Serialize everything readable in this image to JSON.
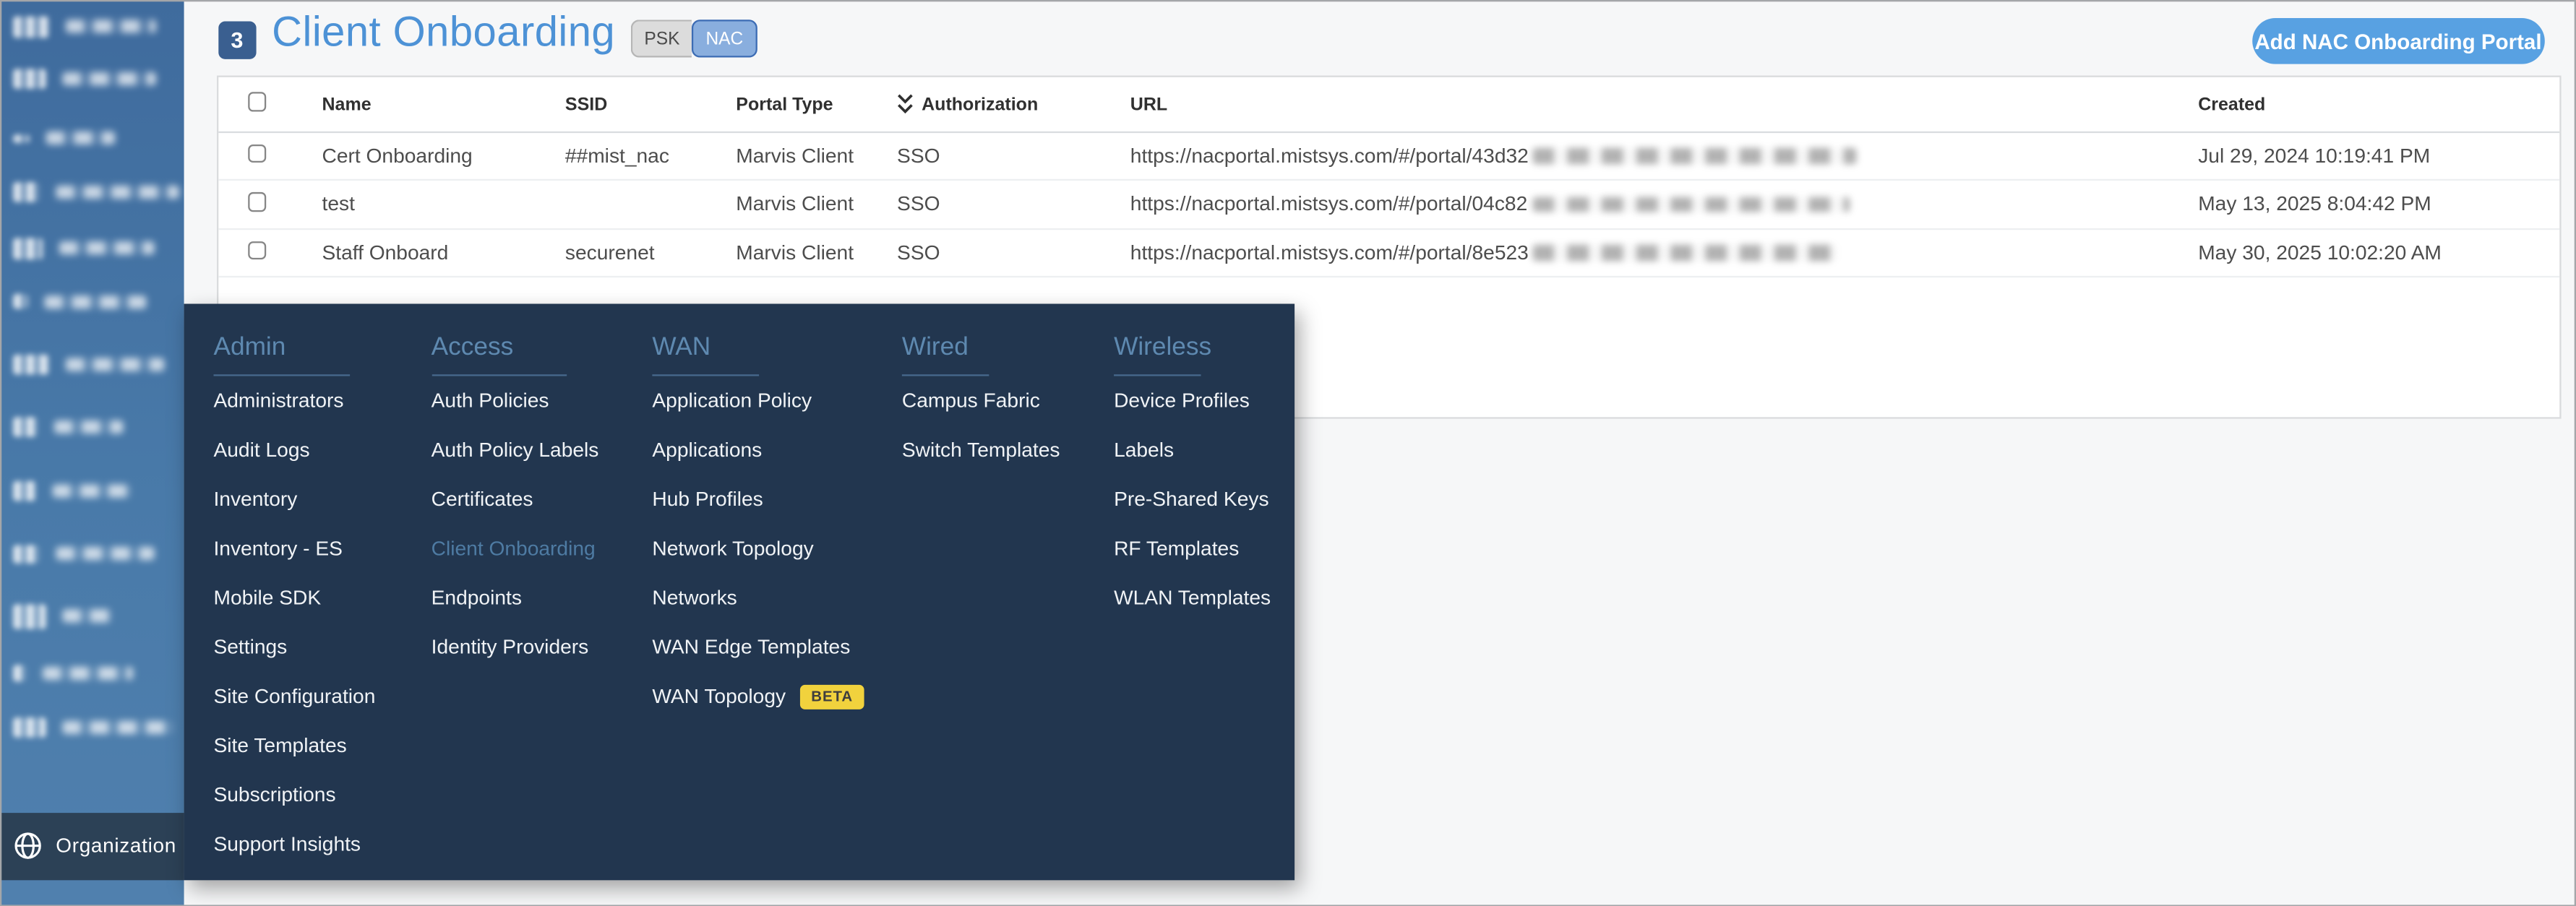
{
  "page": {
    "count_badge": "3",
    "title": "Client Onboarding",
    "toggle": {
      "options": [
        "PSK",
        "NAC"
      ],
      "selected": "NAC"
    },
    "add_button": "Add NAC Onboarding Portal"
  },
  "table": {
    "columns": [
      "Name",
      "SSID",
      "Portal Type",
      "Authorization",
      "URL",
      "Created"
    ],
    "sort": {
      "column": "Authorization",
      "direction": "descending"
    },
    "rows": [
      {
        "name": "Cert Onboarding",
        "ssid": "##mist_nac",
        "portal_type": "Marvis Client",
        "authorization": "SSO",
        "url_visible": "https://nacportal.mistsys.com/#/portal/43d32",
        "url_redacted": true,
        "created": "Jul 29, 2024 10:19:41 PM"
      },
      {
        "name": "test",
        "ssid": "",
        "portal_type": "Marvis Client",
        "authorization": "SSO",
        "url_visible": "https://nacportal.mistsys.com/#/portal/04c82",
        "url_redacted": true,
        "created": "May 13, 2025 8:04:42 PM"
      },
      {
        "name": "Staff Onboard",
        "ssid": "securenet",
        "portal_type": "Marvis Client",
        "authorization": "SSO",
        "url_visible": "https://nacportal.mistsys.com/#/portal/8e523",
        "url_redacted": true,
        "created": "May 30, 2025 10:02:20 AM"
      }
    ]
  },
  "menu": {
    "columns": [
      {
        "title": "Admin",
        "items": [
          "Administrators",
          "Audit Logs",
          "Inventory",
          "Inventory - ES",
          "Mobile SDK",
          "Settings",
          "Site Configuration",
          "Site Templates",
          "Subscriptions",
          "Support Insights"
        ]
      },
      {
        "title": "Access",
        "items": [
          "Auth Policies",
          "Auth Policy Labels",
          "Certificates",
          "Client Onboarding",
          "Endpoints",
          "Identity Providers"
        ],
        "active_item": "Client Onboarding"
      },
      {
        "title": "WAN",
        "items": [
          "Application Policy",
          "Applications",
          "Hub Profiles",
          "Network Topology",
          "Networks",
          "WAN Edge Templates",
          "WAN Topology"
        ],
        "badge": {
          "item": "WAN Topology",
          "label": "BETA"
        }
      },
      {
        "title": "Wired",
        "items": [
          "Campus Fabric",
          "Switch Templates"
        ]
      },
      {
        "title": "Wireless",
        "items": [
          "Device Profiles",
          "Labels",
          "Pre-Shared Keys",
          "RF Templates",
          "WLAN Templates"
        ]
      }
    ]
  },
  "sidebar": {
    "organization_label": "Organization",
    "redacted_item_count": 13
  },
  "colors": {
    "title_blue": "#4d92d6",
    "count_badge_bg": "#3a5f90",
    "nac_selected_bg": "#89aede",
    "nac_selected_border": "#3c6cb4",
    "add_button_bg": "#58a1e2",
    "sidebar_blue": "#497aa9",
    "organization_row_bg": "#2c4156",
    "menu_bg": "#22364f",
    "menu_heading": "#5e89b0",
    "menu_active_item": "#4e7ba3",
    "beta_badge_bg": "#f1d23d",
    "page_bg": "#f6f7f8"
  }
}
